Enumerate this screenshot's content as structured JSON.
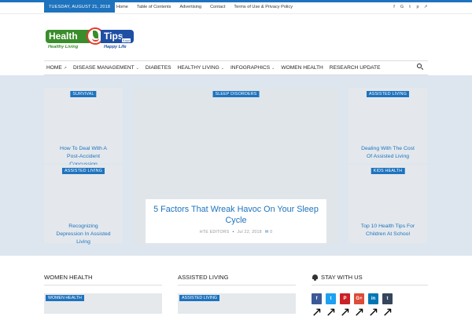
{
  "topbar": {
    "date": "TUESDAY, AUGUST 21, 2018",
    "links": [
      "Home",
      "Table of Contents",
      "Advertising",
      "Contact",
      "Terms of Use & Privacy Policy"
    ],
    "social_icons": [
      "facebook-icon",
      "google-plus-icon",
      "twitter-icon",
      "pinterest-icon",
      "external-link-icon"
    ]
  },
  "logo": {
    "word_left": "Health",
    "word_right": "Tips",
    "stamp": "Expo",
    "tagline_left": "Healthy Living",
    "tagline_right": "Happy Life"
  },
  "nav": {
    "items": [
      {
        "label": "HOME",
        "suffix": "↗"
      },
      {
        "label": "DISEASE MANAGEMENT",
        "suffix": "⌄"
      },
      {
        "label": "DIABETES",
        "suffix": ""
      },
      {
        "label": "HEALTHY LIVING",
        "suffix": "⌄"
      },
      {
        "label": "INFOGRAPHICS",
        "suffix": "⌄"
      },
      {
        "label": "WOMEN HEALTH",
        "suffix": ""
      },
      {
        "label": "RESEARCH UPDATE",
        "suffix": ""
      }
    ],
    "search_icon": "search-icon"
  },
  "hero": {
    "left_top": {
      "category": "SURVIVAL",
      "title": "How To Deal With A Post-Accident Concussion"
    },
    "left_bottom": {
      "category": "ASSISTED LIVING",
      "title": "Recognizing Depression In Assisted Living"
    },
    "featured": {
      "category": "SLEEP DISORDERS",
      "title": "5 Factors That Wreak Havoc On Your Sleep Cycle",
      "author": "HTE EDITORS",
      "date": "Jul 22, 2018",
      "comments": "0"
    },
    "right_top": {
      "category": "ASSISTED LIVING",
      "title": "Dealing With The Cost Of Assisted Living"
    },
    "right_bottom": {
      "category": "KIDS HEALTH",
      "title": "Top 10 Health Tips For Children At School"
    }
  },
  "sections": {
    "women_health": {
      "heading": "WOMEN HEALTH",
      "category": "WOMEN HEALTH"
    },
    "assisted_living": {
      "heading": "ASSISTED LIVING",
      "category": "ASSISTED LIVING"
    },
    "stay_with_us": {
      "heading": "STAY WITH US"
    }
  },
  "social_buttons": [
    {
      "label": "f",
      "icon": "facebook-icon",
      "color": "#3b5998"
    },
    {
      "label": "t",
      "icon": "twitter-icon",
      "color": "#1da1f2"
    },
    {
      "label": "P",
      "icon": "pinterest-icon",
      "color": "#cb2027"
    },
    {
      "label": "G+",
      "icon": "google-plus-icon",
      "color": "#dd4b39"
    },
    {
      "label": "in",
      "icon": "linkedin-icon",
      "color": "#0077b5"
    },
    {
      "label": "t",
      "icon": "tumblr-icon",
      "color": "#35465c"
    }
  ],
  "colors": {
    "accent": "#1e73be",
    "hero_bg": "#dde6ee"
  }
}
